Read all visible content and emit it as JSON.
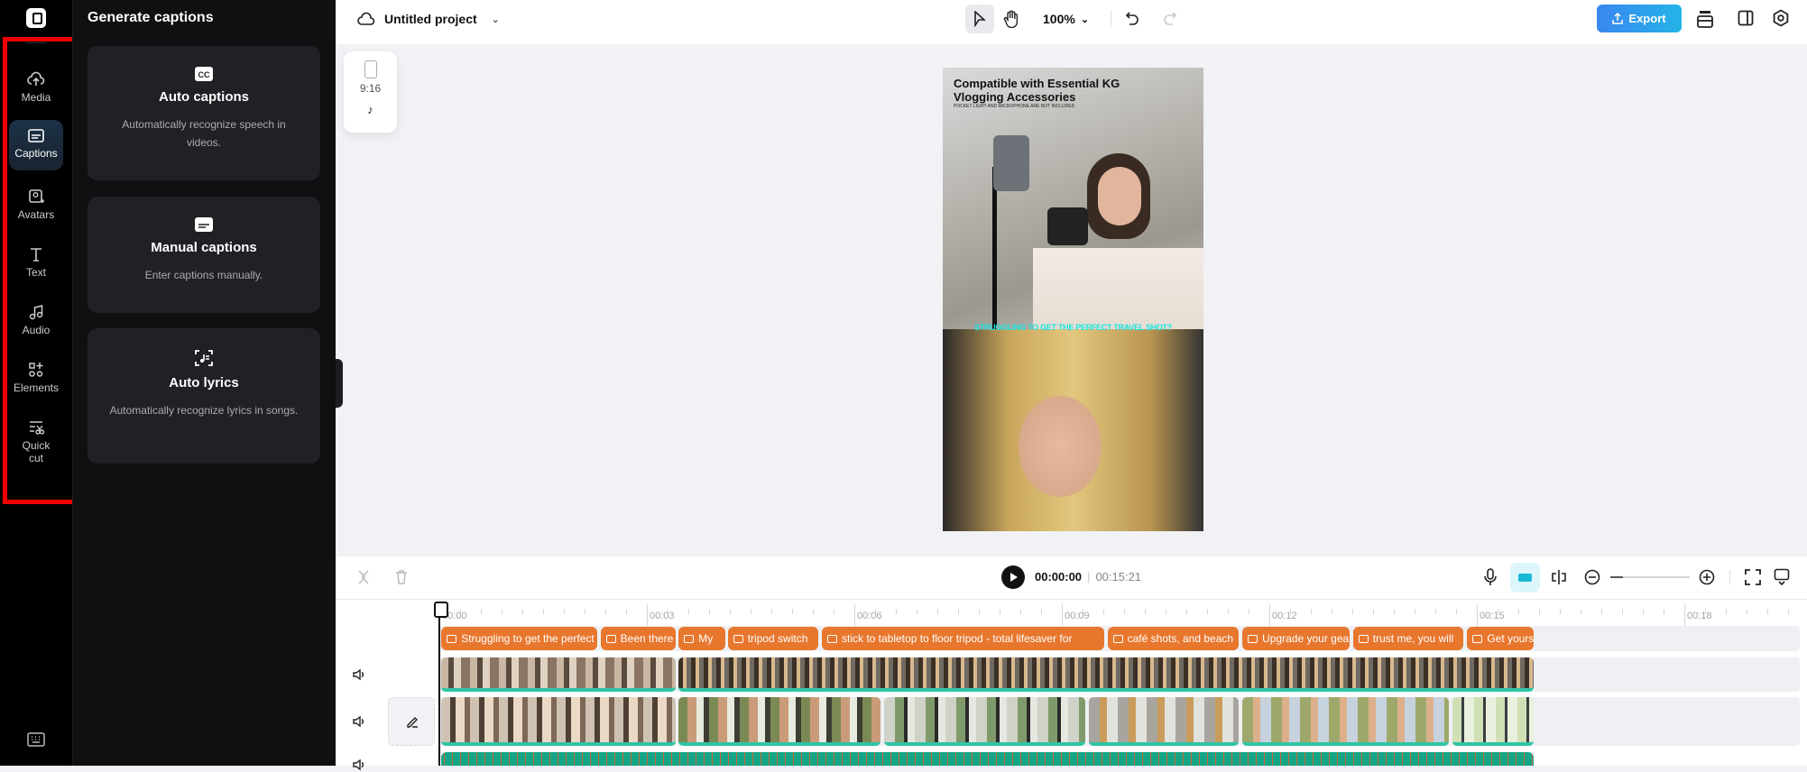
{
  "sidebar": {
    "items": [
      {
        "label": "Media",
        "icon": "cloud-upload-icon"
      },
      {
        "label": "Captions",
        "icon": "captions-icon",
        "active": true
      },
      {
        "label": "Avatars",
        "icon": "avatar-icon"
      },
      {
        "label": "Text",
        "icon": "text-icon"
      },
      {
        "label": "Audio",
        "icon": "music-note-icon"
      },
      {
        "label": "Elements",
        "icon": "elements-icon"
      },
      {
        "label": "Quick cut",
        "icon": "quick-cut-icon"
      }
    ]
  },
  "panel": {
    "title": "Generate captions",
    "cards": [
      {
        "title": "Auto captions",
        "desc": "Automatically recognize speech in videos."
      },
      {
        "title": "Manual captions",
        "desc": "Enter captions manually."
      },
      {
        "title": "Auto lyrics",
        "desc": "Automatically recognize lyrics in songs."
      }
    ]
  },
  "topbar": {
    "project_title": "Untitled project",
    "zoom": "100%",
    "export_label": "Export"
  },
  "canvas": {
    "aspect_ratio": "9:16",
    "video": {
      "headline": "Compatible with Essential KG Vlogging Accessories",
      "subline": "POCKET LIGHT AND MICROPHONE ARE NOT INCLUDED",
      "caption": "STRUGGLING TO GET THE PERFECT TRAVEL SHOT?"
    }
  },
  "timeline": {
    "current_time": "00:00:00",
    "separator": "|",
    "duration": "00:15:21",
    "ruler": [
      "00:00",
      "00:03",
      "00:06",
      "00:09",
      "00:12",
      "00:15",
      "00:18"
    ],
    "captions": [
      {
        "text": "Struggling to get the perfect travel shot?",
        "start": 0.03,
        "end": 2.28
      },
      {
        "text": "Been there",
        "start": 2.33,
        "end": 3.42
      },
      {
        "text": "My",
        "start": 3.46,
        "end": 4.13
      },
      {
        "text": "tripod switch",
        "start": 4.17,
        "end": 5.48
      },
      {
        "text": "stick to tabletop to floor tripod - total lifesaver for",
        "start": 5.53,
        "end": 9.61
      },
      {
        "text": "café shots, and beach",
        "start": 9.66,
        "end": 11.56
      },
      {
        "text": "Upgrade your gear",
        "start": 11.61,
        "end": 13.16
      },
      {
        "text": "trust me, you will",
        "start": 13.21,
        "end": 14.8
      },
      {
        "text": "Get yours",
        "start": 14.86,
        "end": 15.82
      }
    ],
    "track1_clips": [
      {
        "start": 0.03,
        "end": 3.42
      },
      {
        "start": 3.46,
        "end": 15.82
      }
    ],
    "track2_clips": [
      {
        "start": 0.03,
        "end": 3.42
      },
      {
        "start": 3.46,
        "end": 6.38
      },
      {
        "start": 6.43,
        "end": 9.34
      },
      {
        "start": 9.39,
        "end": 11.56
      },
      {
        "start": 11.61,
        "end": 14.6
      },
      {
        "start": 14.65,
        "end": 15.82
      }
    ],
    "audio_clip": {
      "start": 0.03,
      "end": 15.82
    }
  },
  "colors": {
    "accent": "#e8772e",
    "highlight": "#f20000",
    "export": "#3a86f0"
  }
}
